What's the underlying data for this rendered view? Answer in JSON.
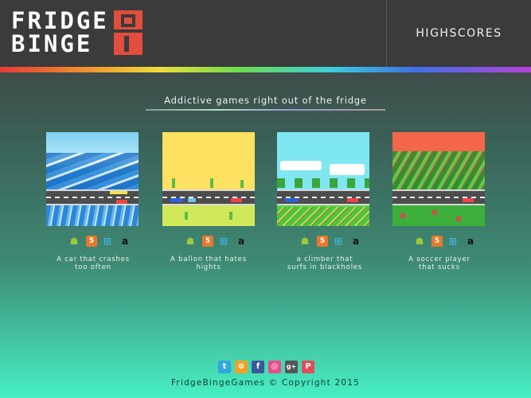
{
  "header": {
    "logo_line1": "FRIDGE",
    "logo_line2": "BINGE",
    "highscores": "HIGHSCORES"
  },
  "tagline": "Addictive games right out of the fridge",
  "games": [
    {
      "description_line1": "A car that crashes",
      "description_line2": "too often"
    },
    {
      "description_line1": "A ballon that hates",
      "description_line2": "hights"
    },
    {
      "description_line1": "a climber that",
      "description_line2": "surfs in blackholes"
    },
    {
      "description_line1": "A soccer player",
      "description_line2": "that sucks"
    }
  ],
  "platforms": [
    {
      "icon": "apple-icon",
      "glyph": ""
    },
    {
      "icon": "android-icon",
      "glyph": "☗"
    },
    {
      "icon": "html5-icon",
      "glyph": "5"
    },
    {
      "icon": "windows-icon",
      "glyph": "⊞"
    },
    {
      "icon": "amazon-icon",
      "glyph": "a"
    }
  ],
  "socials": [
    {
      "icon": "twitter-icon",
      "glyph": "t",
      "color": "#2fa8e0"
    },
    {
      "icon": "rss-icon",
      "glyph": "⊚",
      "color": "#f5a024"
    },
    {
      "icon": "facebook-icon",
      "glyph": "f",
      "color": "#3b5998"
    },
    {
      "icon": "dribbble-icon",
      "glyph": "◎",
      "color": "#ea4c89"
    },
    {
      "icon": "google-plus-icon",
      "glyph": "g+",
      "color": "#555"
    },
    {
      "icon": "pinterest-icon",
      "glyph": "P",
      "color": "#e64b5a"
    }
  ],
  "footer": "FridgeBingeGames © Copyright 2015"
}
